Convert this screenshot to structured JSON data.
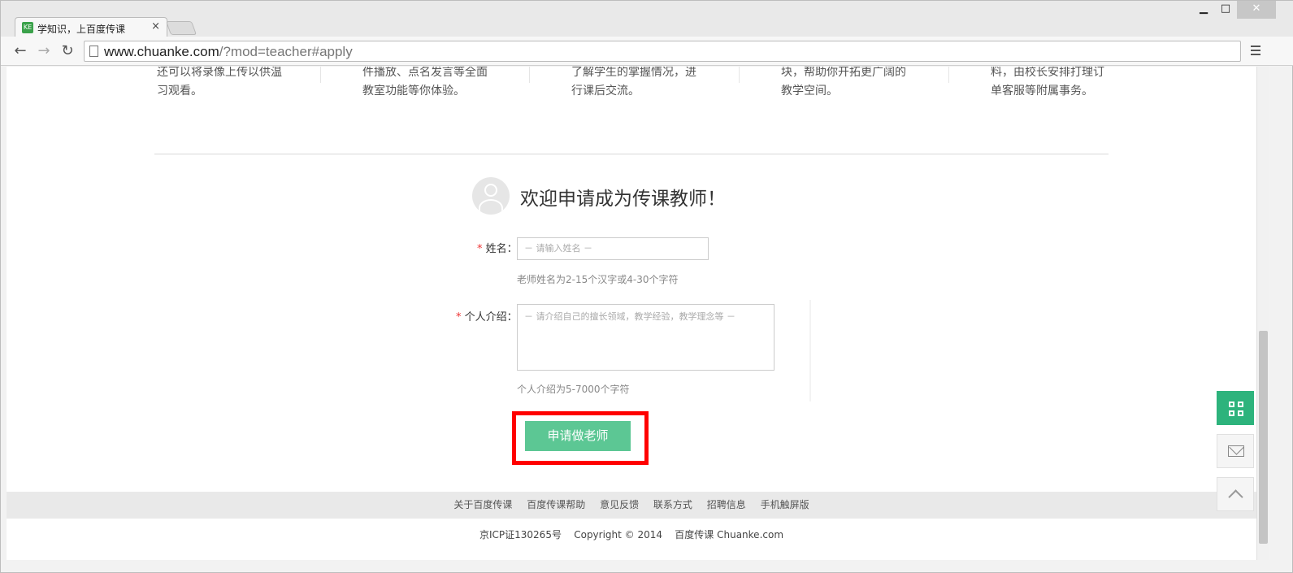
{
  "browser": {
    "tab_title": "学知识，上百度传课",
    "tab_close": "×",
    "favicon_text": "KE",
    "window_min": "▁",
    "window_max": "□",
    "window_close": "✕",
    "nav_back": "←",
    "nav_forward": "→",
    "nav_reload": "↻",
    "url_host": "www.chuanke.com",
    "url_rest": "/?mod=teacher#apply"
  },
  "features": [
    {
      "line1": "还可以将录像上传以供温",
      "line2": "习观看。"
    },
    {
      "line1": "件播放、点名发言等全面",
      "line2": "教室功能等你体验。"
    },
    {
      "line1": "了解学生的掌握情况，进",
      "line2": "行课后交流。"
    },
    {
      "line1": "块，帮助你开拓更广阔的",
      "line2": "教学空间。"
    },
    {
      "line1": "料，由校长安排打理订",
      "line2": "单客服等附属事务。"
    }
  ],
  "form": {
    "title": "欢迎申请成为传课教师！",
    "required_mark": "*",
    "name_label": "姓名：",
    "name_placeholder": "－ 请输入姓名 －",
    "name_hint": "老师姓名为2-15个汉字或4-30个字符",
    "intro_label": "个人介绍：",
    "intro_placeholder": "－ 请介绍自己的擅长领域，教学经验，教学理念等 －",
    "intro_hint": "个人介绍为5-7000个字符",
    "apply_button": "申请做老师"
  },
  "footer": {
    "links": [
      "关于百度传课",
      "百度传课帮助",
      "意见反馈",
      "联系方式",
      "招聘信息",
      "手机触屏版"
    ],
    "icp": "京ICP证130265号",
    "copyright": "Copyright © 2014",
    "brand": "百度传课 Chuanke.com"
  },
  "colors": {
    "accent_green": "#5cc794",
    "qr_green": "#2db37c",
    "highlight_red": "#ff0000"
  }
}
